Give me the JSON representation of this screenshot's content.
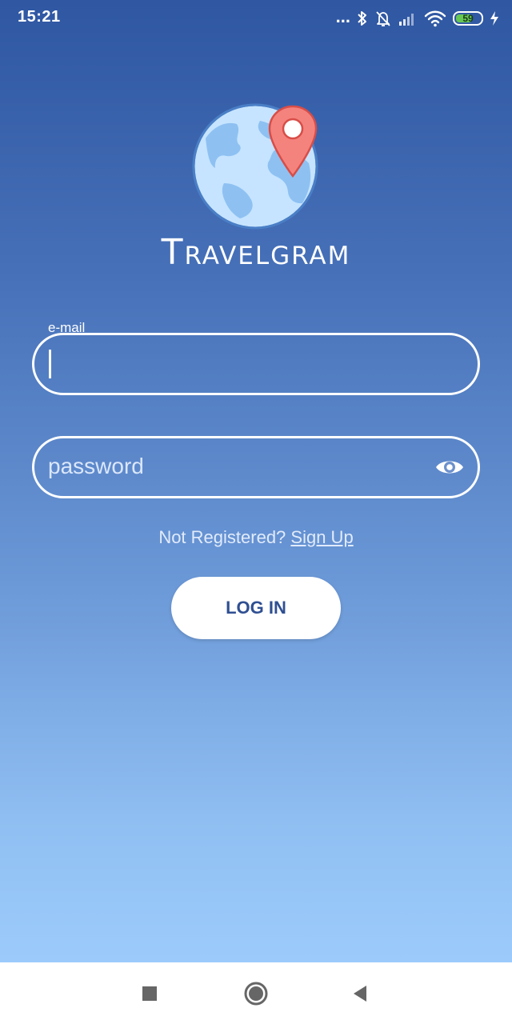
{
  "status_bar": {
    "time": "15:21",
    "dots": "...",
    "battery_level": "59",
    "icons": [
      "bluetooth-icon",
      "mute-bell-icon",
      "signal-icon",
      "wifi-icon",
      "battery-icon",
      "charging-icon"
    ]
  },
  "brand": {
    "name_first": "T",
    "name_rest": "ravelgram"
  },
  "form": {
    "email_label": "e-mail",
    "email_value": "",
    "password_placeholder": "password",
    "register_prompt": "Not Registered? ",
    "signup_link": "Sign Up",
    "login_button": "LOG IN"
  },
  "navigation": {
    "items": [
      "recent-apps-icon",
      "home-icon",
      "back-icon"
    ]
  },
  "colors": {
    "gradient_top": "#2f57a2",
    "gradient_bottom": "#9ccbfb",
    "button_text": "#2f4f92",
    "pin_red": "#f5837d"
  }
}
